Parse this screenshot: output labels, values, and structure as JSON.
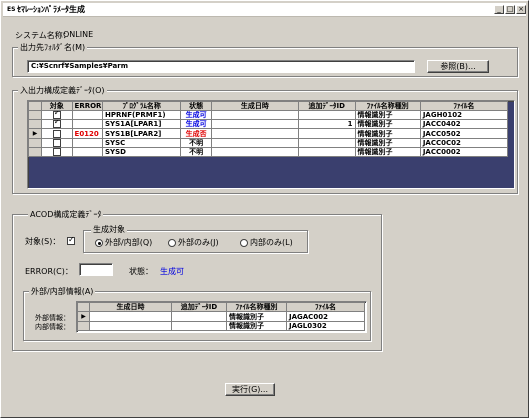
{
  "window": {
    "title": "ｾﾏﾚｰｼｮﾝﾊﾟﾗﾒｰﾀ生成",
    "icon_text": "ES",
    "buttons": [
      "_",
      "□",
      "×"
    ]
  },
  "system_label": "システム名称：",
  "system_name": "ONLINE",
  "output_folder": {
    "group_title": "出力先ﾌｫﾙﾀﾞ名(M)",
    "path": "C:¥Scnrf¥Samples¥Parm",
    "browse_label": "参照(B)..."
  },
  "io_definition": {
    "group_title": "入出力構成定義ﾃﾞｰﾀ(O)",
    "columns": [
      "対象",
      "ERROR",
      "ﾌﾟﾛｸﾞﾗﾑ名称",
      "状態",
      "生成日時",
      "追加ﾃﾞｰﾀID",
      "ﾌｧｲﾙ名称種別",
      "ﾌｧｲﾙ名"
    ],
    "rows": [
      {
        "checked": true,
        "error": "",
        "program": "HPRNF(PRMF1)",
        "status": "生成可",
        "date": "",
        "addid": "",
        "type": "情報識別子",
        "file": "JAGH0102",
        "status_color": "#0000e0",
        "selected": false
      },
      {
        "checked": true,
        "error": "",
        "program": "SYS1A[LPAR1]",
        "status": "生成可",
        "date": "",
        "addid": "1",
        "type": "情報識別子",
        "file": "JACC0402",
        "status_color": "#0000e0",
        "selected": false
      },
      {
        "checked": false,
        "error": "E0120",
        "program": "SYS1B[LPAR2]",
        "status": "生成否",
        "date": "",
        "addid": "",
        "type": "情報識別子",
        "file": "JACC0502",
        "status_color": "#e00000",
        "selected": true
      },
      {
        "checked": false,
        "error": "",
        "program": "SYSC",
        "status": "不明",
        "date": "",
        "addid": "",
        "type": "情報識別子",
        "file": "JACC0C02",
        "status_color": "#000000",
        "selected": false
      },
      {
        "checked": false,
        "error": "",
        "program": "SYSD",
        "status": "不明",
        "date": "",
        "addid": "",
        "type": "情報識別子",
        "file": "JACC0002",
        "status_color": "#000000",
        "selected": false
      }
    ]
  },
  "acod": {
    "group_title": "ACOD構成定義ﾃﾞｰﾀ",
    "target_label": "対象(S)：",
    "target_checked": true,
    "generate_target": {
      "title": "生成対象",
      "options": [
        {
          "label": "外部/内部(Q)",
          "selected": true
        },
        {
          "label": "外部のみ(J)",
          "selected": false
        },
        {
          "label": "内部のみ(L)",
          "selected": false
        }
      ]
    },
    "error_label": "ERROR(C)：",
    "error_value": "",
    "status_label": "状態：",
    "status_value": "生成可",
    "ext_int": {
      "group_title": "外部/内部情報(A)",
      "columns": [
        "生成日時",
        "追加ﾃﾞｰﾀID",
        "ﾌｧｲﾙ名称種別",
        "ﾌｧｲﾙ名"
      ],
      "rows": [
        {
          "label": "外部情報：",
          "date": "",
          "addid": "",
          "type": "情報識別子",
          "file": "JAGAC002"
        },
        {
          "label": "内部情報：",
          "date": "",
          "addid": "",
          "type": "情報識別子",
          "file": "JAGL0302"
        }
      ]
    }
  },
  "execute_label": "実行(G)...",
  "colors": {
    "face": "#d4d0c8",
    "selection": "#0a246a",
    "ok_blue": "#0000e0",
    "ng_red": "#e00000",
    "grid_empty": "#3a3f6e"
  }
}
